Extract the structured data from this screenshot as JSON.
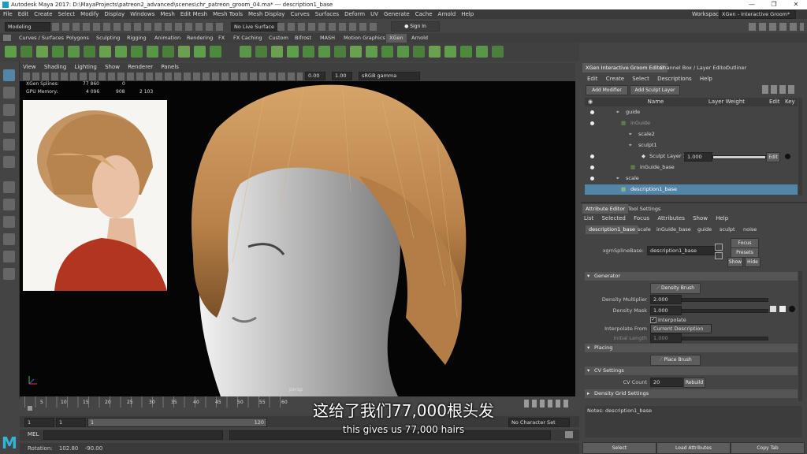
{
  "titlebar": {
    "title": "Autodesk Maya 2017: D:\\MayaProjects\\patreon2_advanced\\scenes\\chr_patreon_groom_04.ma*   ---   description1_base",
    "minimize": "—",
    "maximize": "❐",
    "close": "✕"
  },
  "menubar": [
    "File",
    "Edit",
    "Create",
    "Select",
    "Modify",
    "Display",
    "Windows",
    "Mesh",
    "Edit Mesh",
    "Mesh Tools",
    "Mesh Display",
    "Curves",
    "Surfaces",
    "Deform",
    "UV",
    "Generate",
    "Cache",
    "Arnold",
    "Help"
  ],
  "workspace": {
    "label": "Workspace :",
    "value": "XGen - Interactive Groom*"
  },
  "statusline": {
    "mode": "Modeling",
    "live_surface": "No Live Surface",
    "sign_in": "Sign In"
  },
  "shelf_tabs": [
    "Curves / Surfaces",
    "Polygons",
    "Sculpting",
    "Rigging",
    "Animation",
    "Rendering",
    "FX",
    "FX Caching",
    "Custom",
    "Bifrost",
    "MASH",
    "Motion Graphics",
    "XGen",
    "Arnold"
  ],
  "shelf_active_tab": "XGen",
  "viewport": {
    "menu": [
      "View",
      "Shading",
      "Lighting",
      "Show",
      "Renderer",
      "Panels"
    ],
    "exposure": "0.00",
    "gamma": "1.00",
    "color_space": "sRGB gamma",
    "hud": {
      "splines_label": "XGen Splines:",
      "splines_value": "77 860",
      "splines_extra": "0",
      "gpu_label": "GPU Memory:",
      "gpu_value1": "4 096",
      "gpu_value2": "908",
      "gpu_value3": "2 103"
    },
    "camera_label": "persp"
  },
  "timeline": {
    "ticks": [
      "1",
      "5",
      "10",
      "15",
      "20",
      "25",
      "30",
      "35",
      "40",
      "45",
      "50",
      "55",
      "60",
      "65",
      "70",
      "75",
      "80",
      "85",
      "90",
      "95",
      "100",
      "105",
      "110",
      "115",
      "120"
    ],
    "start": "1",
    "current": "1",
    "range_start": "1",
    "range_end": "120",
    "character_set": "No Character Set"
  },
  "cmdline": {
    "label": "MEL"
  },
  "helpline": {
    "rotation_label": "Rotation:",
    "x": "102.80",
    "y": "-90.00"
  },
  "subtitles": {
    "chinese": "这给了我们77,000根头发",
    "english": "this gives us 77,000 hairs"
  },
  "groom_editor": {
    "tabs": [
      "XGen Interactive Groom Editor",
      "Channel Box / Layer Editor",
      "Outliner"
    ],
    "menu": [
      "Edit",
      "Create",
      "Select",
      "Descriptions",
      "Help"
    ],
    "add_modifier": "Add Modifier",
    "add_sculpt_layer": "Add Sculpt Layer",
    "columns": {
      "name": "Name",
      "layer_weight": "Layer Weight",
      "edit": "Edit",
      "key": "Key"
    },
    "tree": [
      {
        "label": "guide",
        "indent": 0
      },
      {
        "label": "inGuide",
        "indent": 1
      },
      {
        "label": "scale2",
        "indent": 2
      },
      {
        "label": "sculpt1",
        "indent": 2
      },
      {
        "label": "Sculpt Layer 1",
        "indent": 3,
        "weight": "1.000",
        "edit": "Edit"
      },
      {
        "label": "inGuide_base",
        "indent": 2
      },
      {
        "label": "scale",
        "indent": 0
      },
      {
        "label": "description1_base",
        "indent": 1,
        "selected": true
      }
    ]
  },
  "attribute_editor": {
    "tabs": [
      "Attribute Editor",
      "Tool Settings"
    ],
    "menu": [
      "List",
      "Selected",
      "Focus",
      "Attributes",
      "Show",
      "Help"
    ],
    "node_tabs": [
      "description1_base",
      "scale",
      "inGuide_base",
      "guide",
      "sculpt",
      "noise"
    ],
    "node_type_label": "xgmSplineBase:",
    "node_name": "description1_base",
    "focus": "Focus",
    "presets": "Presets",
    "show": "Show",
    "hide": "Hide",
    "generator": {
      "title": "Generator",
      "density_brush": "Density Brush",
      "density_multiplier_label": "Density Multiplier",
      "density_multiplier": "2.000",
      "density_mask_label": "Density Mask",
      "density_mask": "1.000",
      "interpolate_label": "Interpolate",
      "interpolate_from_label": "Interpolate From",
      "interpolate_from": "Current Description",
      "initial_length_label": "Initial Length",
      "initial_length": "1.000"
    },
    "placing": {
      "title": "Placing",
      "place_brush": "Place Brush"
    },
    "cv_settings": {
      "title": "CV Settings",
      "cv_count_label": "CV Count",
      "cv_count": "20",
      "rebuild": "Rebuild"
    },
    "density_grid": {
      "title": "Density Grid Settings"
    },
    "notes_label": "Notes:  description1_base",
    "footer": [
      "Select",
      "Load Attributes",
      "Copy Tab"
    ]
  },
  "colors": {
    "accent": "#5285a6",
    "selection": "#5285a6",
    "hair": "#c8955a"
  }
}
